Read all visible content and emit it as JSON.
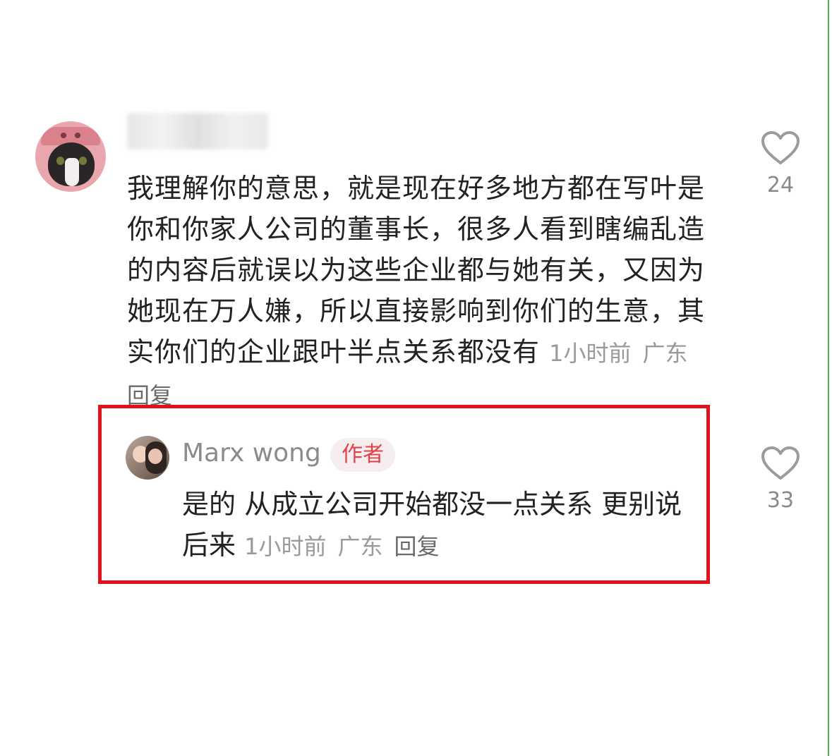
{
  "parent_comment": {
    "text": "我理解你的意思，就是现在好多地方都在写叶是你和你家人公司的董事长，很多人看到瞎编乱造的内容后就误以为这些企业都与她有关，又因为她现在万人嫌，所以直接影响到你们的生意，其实你们的企业跟叶半点关系都没有",
    "time": "1小时前",
    "location": "广东",
    "reply_label": "回复",
    "likes": "24"
  },
  "reply_comment": {
    "username": "Marx wong",
    "badge": "作者",
    "text": "是的 从成立公司开始都没一点关系 更别说后来",
    "time": "1小时前",
    "location": "广东",
    "reply_label": "回复",
    "likes": "33"
  },
  "colors": {
    "highlight_border": "#e0131c",
    "badge_text": "#e0424c",
    "badge_bg": "#f6eeee",
    "meta_text": "#9a9a9a"
  },
  "icons": {
    "like": "heart-outline-icon"
  }
}
